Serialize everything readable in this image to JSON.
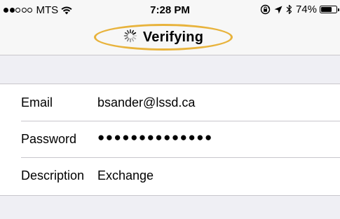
{
  "status_bar": {
    "carrier": "MTS",
    "signal": {
      "filled": 2,
      "total": 5
    },
    "time": "7:28 PM",
    "battery_percent": "74%",
    "battery_level": 0.74
  },
  "nav": {
    "title": "Verifying",
    "highlight_color": "#e8b33c"
  },
  "form": {
    "rows": [
      {
        "label": "Email",
        "value": "bsander@lssd.ca"
      },
      {
        "label": "Password",
        "value": "●●●●●●●●●●●●●●"
      },
      {
        "label": "Description",
        "value": "Exchange"
      }
    ]
  },
  "icons": [
    "wifi-icon",
    "rotation-lock-icon",
    "location-arrow-icon",
    "bluetooth-icon",
    "battery-icon",
    "spinner-icon"
  ]
}
